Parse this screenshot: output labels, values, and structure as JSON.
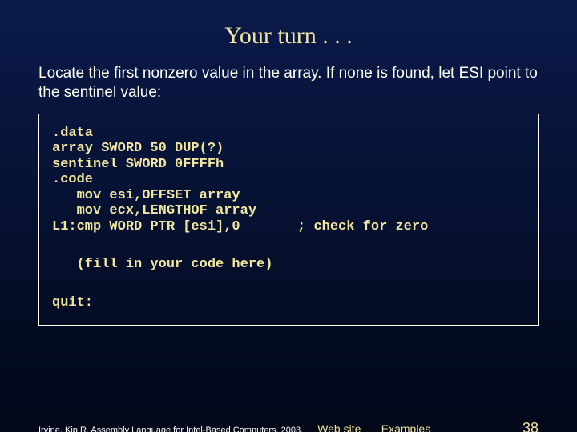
{
  "title": "Your turn . . .",
  "instruction": "Locate the first nonzero value in the array. If none is found, let ESI point to the sentinel value:",
  "code": {
    "block1": ".data\narray SWORD 50 DUP(?)\nsentinel SWORD 0FFFFh\n.code\n   mov esi,OFFSET array\n   mov ecx,LENGTHOF array\nL1:cmp WORD PTR [esi],0       ; check for zero",
    "fill": "   (fill in your code here)",
    "block2": "quit:"
  },
  "footer": {
    "credit": "Irvine, Kip R. Assembly Language for Intel-Based Computers, 2003.",
    "link1": "Web site",
    "link2": "Examples",
    "page": "38"
  }
}
